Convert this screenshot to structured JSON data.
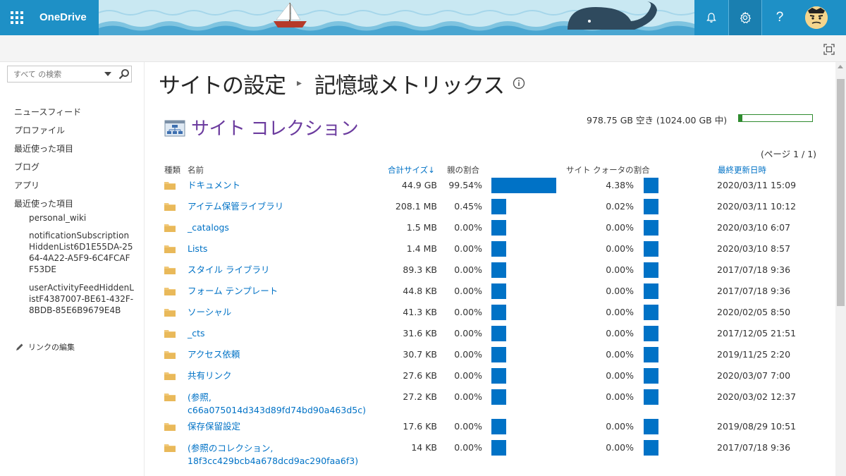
{
  "suite_bar": {
    "brand": "OneDrive",
    "buttons": [
      "notifications",
      "settings",
      "help",
      "account"
    ]
  },
  "colors": {
    "suite": "#1e90c6",
    "link": "#0072c6",
    "section_title": "#6b3b9e",
    "bar": "#0072c6",
    "storage_bar": "#2e8b2e"
  },
  "search": {
    "placeholder": "すべて の検索"
  },
  "nav": {
    "items": [
      "ニュースフィード",
      "プロファイル",
      "最近使った項目",
      "ブログ",
      "アプリ",
      "最近使った項目"
    ],
    "recent": [
      "personal_wiki",
      "notificationSubscriptionHiddenList6D1E55DA-2564-4A22-A5F9-6C4FCAFF53DE",
      "userActivityFeedHiddenListF4387007-BE61-432F-8BDB-85E6B9679E4B"
    ],
    "edit_links": "リンクの編集"
  },
  "page": {
    "breadcrumb_parent": "サイトの設定",
    "breadcrumb_current": "記憶域メトリックス",
    "section_title": "サイト コレクション",
    "storage_text": "978.75 GB 空き (1024.00 GB 中)",
    "storage_used_fraction": 0.044,
    "page_info": "(ページ 1 / 1)"
  },
  "table": {
    "headers": {
      "type": "種類",
      "name": "名前",
      "total_size": "合計サイズ",
      "parent_pct": "親の割合",
      "quota_pct": "サイト クォータの割合",
      "modified": "最終更新日時"
    },
    "rows": [
      {
        "name": "ドキュメント",
        "size": "44.9 GB",
        "parent": "99.54%",
        "parent_val": 99.54,
        "quota": "4.38%",
        "quota_val": 4.38,
        "date": "2020/03/11 15:09"
      },
      {
        "name": "アイテム保管ライブラリ",
        "size": "208.1 MB",
        "parent": "0.45%",
        "parent_val": 0.45,
        "quota": "0.02%",
        "quota_val": 0.02,
        "date": "2020/03/11 10:12"
      },
      {
        "name": "_catalogs",
        "size": "1.5 MB",
        "parent": "0.00%",
        "parent_val": 0,
        "quota": "0.00%",
        "quota_val": 0,
        "date": "2020/03/10 6:07"
      },
      {
        "name": "Lists",
        "size": "1.4 MB",
        "parent": "0.00%",
        "parent_val": 0,
        "quota": "0.00%",
        "quota_val": 0,
        "date": "2020/03/10 8:57"
      },
      {
        "name": "スタイル ライブラリ",
        "size": "89.3 KB",
        "parent": "0.00%",
        "parent_val": 0,
        "quota": "0.00%",
        "quota_val": 0,
        "date": "2017/07/18 9:36"
      },
      {
        "name": "フォーム テンプレート",
        "size": "44.8 KB",
        "parent": "0.00%",
        "parent_val": 0,
        "quota": "0.00%",
        "quota_val": 0,
        "date": "2017/07/18 9:36"
      },
      {
        "name": "ソーシャル",
        "size": "41.3 KB",
        "parent": "0.00%",
        "parent_val": 0,
        "quota": "0.00%",
        "quota_val": 0,
        "date": "2020/02/05 8:50"
      },
      {
        "name": "_cts",
        "size": "31.6 KB",
        "parent": "0.00%",
        "parent_val": 0,
        "quota": "0.00%",
        "quota_val": 0,
        "date": "2017/12/05 21:51"
      },
      {
        "name": "アクセス依頼",
        "size": "30.7 KB",
        "parent": "0.00%",
        "parent_val": 0,
        "quota": "0.00%",
        "quota_val": 0,
        "date": "2019/11/25 2:20"
      },
      {
        "name": "共有リンク",
        "size": "27.6 KB",
        "parent": "0.00%",
        "parent_val": 0,
        "quota": "0.00%",
        "quota_val": 0,
        "date": "2020/03/07 7:00"
      },
      {
        "name": "(参照, c66a075014d343d89fd74bd90a463d5c)",
        "size": "27.2 KB",
        "parent": "0.00%",
        "parent_val": 0,
        "quota": "0.00%",
        "quota_val": 0,
        "date": "2020/03/02 12:37"
      },
      {
        "name": "保存保留設定",
        "size": "17.6 KB",
        "parent": "0.00%",
        "parent_val": 0,
        "quota": "0.00%",
        "quota_val": 0,
        "date": "2019/08/29 10:51"
      },
      {
        "name": "(参照のコレクション, 18f3cc429bcb4a678dcd9ac290faa6f3)",
        "size": "14 KB",
        "parent": "0.00%",
        "parent_val": 0,
        "quota": "0.00%",
        "quota_val": 0,
        "date": "2017/07/18 9:36"
      }
    ]
  }
}
